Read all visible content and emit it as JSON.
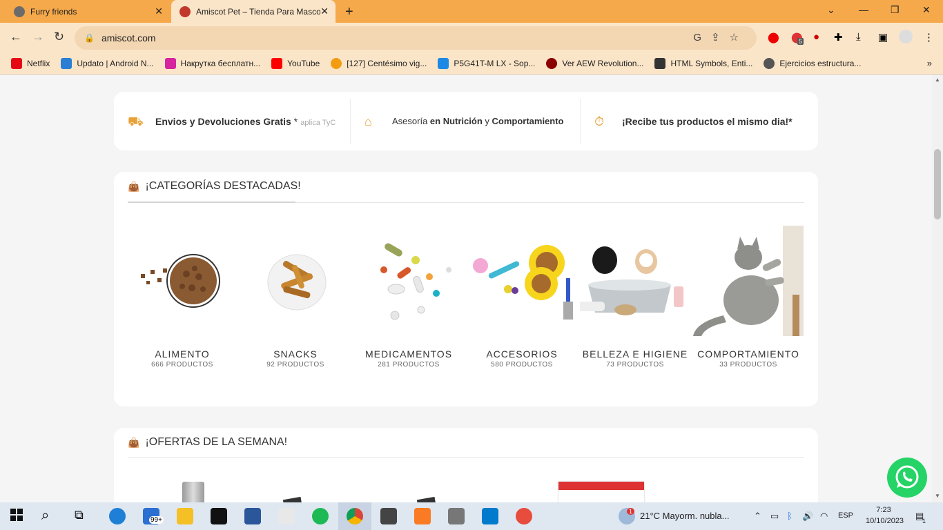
{
  "browser": {
    "tabs": [
      {
        "title": "Furry friends",
        "active": false
      },
      {
        "title": "Amiscot Pet – Tienda Para Mascotas",
        "active": true
      }
    ],
    "url": "amiscot.com",
    "bookmarks": [
      {
        "label": "Netflix",
        "color": "#e50914"
      },
      {
        "label": "Updato | Android N...",
        "color": "#2a7fd4"
      },
      {
        "label": "Накрутка бесплатн...",
        "color": "#d6249f"
      },
      {
        "label": "YouTube",
        "color": "#ff0000"
      },
      {
        "label": "[127] Centésimo vig...",
        "color": "#f39c12"
      },
      {
        "label": "P5G41T-M LX - Sop...",
        "color": "#1e88e5"
      },
      {
        "label": "Ver AEW Revolution...",
        "color": "#8b0000"
      },
      {
        "label": "HTML Symbols, Enti...",
        "color": "#333333"
      },
      {
        "label": "Ejercicios estructura...",
        "color": "#555555"
      }
    ],
    "ext_badge": "5"
  },
  "benefits": [
    {
      "bold": "Envios y Devoluciones Gratis",
      "suffix": " *",
      "small": "aplica TyC",
      "icon": "truck-icon"
    },
    {
      "text1": "Asesoría ",
      "bold1": "en Nutrición",
      "text2": " y ",
      "bold2": "Comportamiento",
      "icon": "pet-bed-icon"
    },
    {
      "bold": "¡Recibe tus productos el mismo dia!*",
      "icon": "stopwatch-icon"
    }
  ],
  "categories_section": {
    "title": "¡CATEGORÍAS DESTACADAS!",
    "items": [
      {
        "name": "ALIMENTO",
        "count": "666 PRODUCTOS"
      },
      {
        "name": "SNACKS",
        "count": "92 PRODUCTOS"
      },
      {
        "name": "MEDICAMENTOS",
        "count": "281 PRODUCTOS"
      },
      {
        "name": "ACCESORIOS",
        "count": "580 PRODUCTOS"
      },
      {
        "name": "BELLEZA E HIGIENE",
        "count": "73 PRODUCTOS"
      },
      {
        "name": "COMPORTAMIENTO",
        "count": "33 PRODUCTOS"
      }
    ]
  },
  "offers_section": {
    "title": "¡OFERTAS DE LA SEMANA!"
  },
  "taskbar": {
    "mail_badge": "99+",
    "weather": "21°C  Mayorm. nubla...",
    "weather_badge": "1",
    "lang": "ESP",
    "time": "7:23",
    "date": "10/10/2023",
    "notif_count": "1"
  },
  "colors": {
    "chrome": "#f6a94a",
    "toolbar": "#fbe5c8",
    "accent": "#e8a23a",
    "whatsapp": "#25d366"
  }
}
